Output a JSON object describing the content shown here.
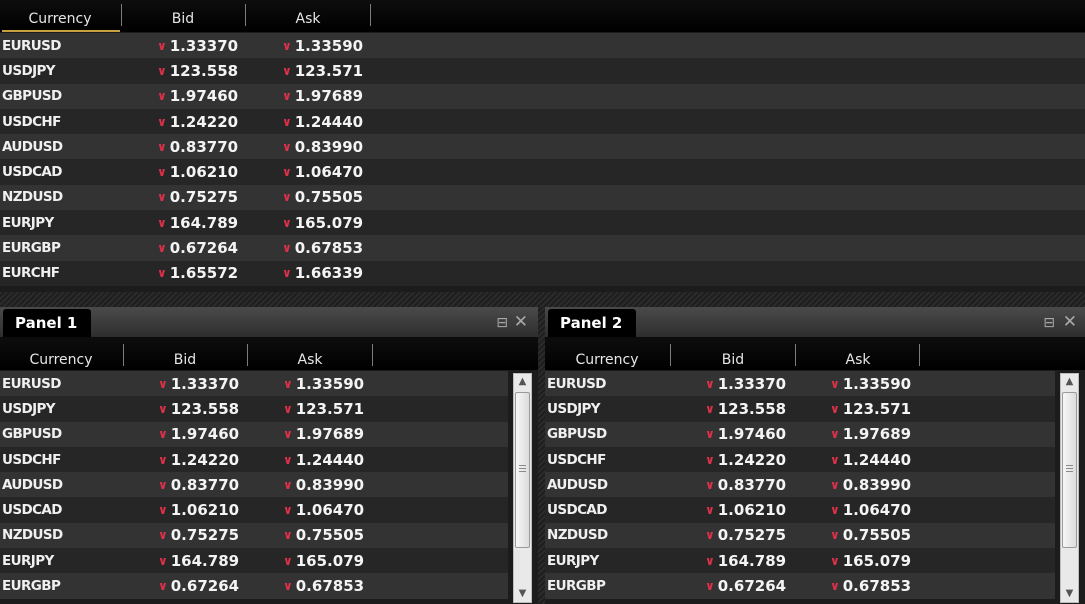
{
  "columns": [
    "Currency",
    "Bid",
    "Ask"
  ],
  "rates": [
    {
      "symbol": "EURUSD",
      "bid": "1.33370",
      "ask": "1.33590"
    },
    {
      "symbol": "USDJPY",
      "bid": "123.558",
      "ask": "123.571"
    },
    {
      "symbol": "GBPUSD",
      "bid": "1.97460",
      "ask": "1.97689"
    },
    {
      "symbol": "USDCHF",
      "bid": "1.24220",
      "ask": "1.24440"
    },
    {
      "symbol": "AUDUSD",
      "bid": "0.83770",
      "ask": "0.83990"
    },
    {
      "symbol": "USDCAD",
      "bid": "1.06210",
      "ask": "1.06470"
    },
    {
      "symbol": "NZDUSD",
      "bid": "0.75275",
      "ask": "0.75505"
    },
    {
      "symbol": "EURJPY",
      "bid": "164.789",
      "ask": "165.079"
    },
    {
      "symbol": "EURGBP",
      "bid": "0.67264",
      "ask": "0.67853"
    },
    {
      "symbol": "EURCHF",
      "bid": "1.65572",
      "ask": "1.66339"
    }
  ],
  "panels": [
    {
      "title": "Panel 1",
      "visible_rows": 9
    },
    {
      "title": "Panel 2",
      "visible_rows": 9
    }
  ],
  "icons": {
    "down_arrow": "down-arrow-icon",
    "restore": "restore-icon",
    "close": "close-icon",
    "scroll_up": "scroll-up-arrow-icon",
    "scroll_down": "scroll-down-arrow-icon"
  },
  "colors": {
    "down_arrow": "#e0304a",
    "sort_indicator": "#c8a040"
  }
}
